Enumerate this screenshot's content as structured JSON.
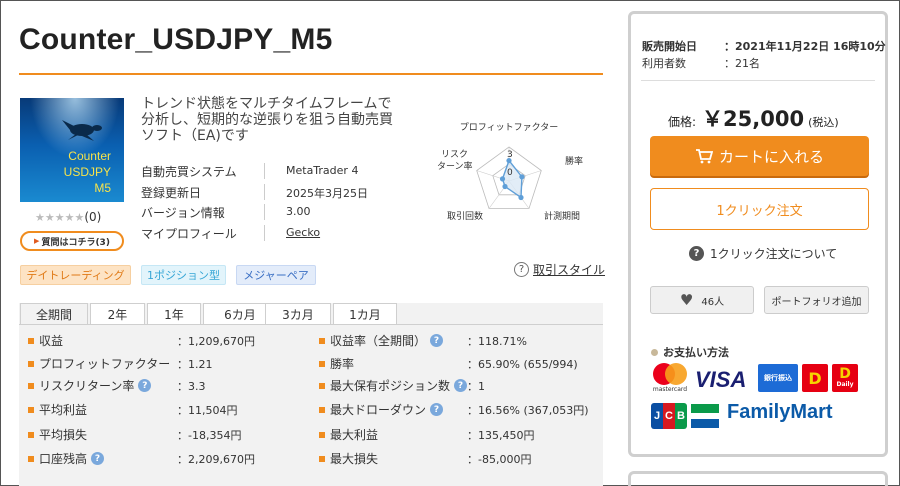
{
  "product": {
    "title": "Counter_USDJPY_M5",
    "image_lines": [
      "Counter",
      "USDJPY",
      "M5"
    ],
    "stars": "★★★★★",
    "review_count": "(0)",
    "qa_button": "質問はコチラ(3)",
    "description": "トレンド状態をマルチタイムフレームで分析し、短期的な逆張りを狙う自動売買ソフト（EA)です"
  },
  "info": [
    {
      "label": "自動売買システム",
      "value": "MetaTrader 4"
    },
    {
      "label": "登録更新日",
      "value": "2025年3月25日"
    },
    {
      "label": "バージョン情報",
      "value": "3.00"
    },
    {
      "label": "マイプロフィール",
      "value": "Gecko"
    }
  ],
  "radar": {
    "axes": [
      "プロフィットファクター",
      "勝率",
      "計測期間",
      "取引回数",
      "リスクターン率"
    ],
    "axis_label_lines": {
      "risk": [
        "リスク",
        "ターン率"
      ]
    },
    "values": [
      3,
      2,
      3,
      1,
      1
    ],
    "max": 5,
    "scale_labels": [
      "3",
      "0"
    ],
    "fill_color": "#dbe8f5",
    "stroke_color": "#5f9fd8"
  },
  "tags": [
    "デイトレーディング",
    "1ポジション型",
    "メジャーペア"
  ],
  "trade_style": {
    "icon": "?",
    "label": "取引スタイル"
  },
  "tabs": [
    "全期間",
    "2年",
    "1年",
    "6カ月",
    "3カ月",
    "1カ月"
  ],
  "active_tab": "全期間",
  "stats_left": [
    {
      "label": "収益",
      "value": "：1,209,670円",
      "help": false
    },
    {
      "label": "プロフィットファクター",
      "value": "：1.21",
      "help": false
    },
    {
      "label": "リスクリターン率",
      "value": "：3.3",
      "help": true
    },
    {
      "label": "平均利益",
      "value": "：11,504円",
      "help": false
    },
    {
      "label": "平均損失",
      "value": "：-18,354円",
      "help": false
    },
    {
      "label": "口座残高",
      "value": "：2,209,670円",
      "help": true
    }
  ],
  "stats_right": [
    {
      "label": "収益率（全期間）",
      "value": "：118.71%",
      "help": true
    },
    {
      "label": "勝率",
      "value": "：65.90% (655/994)",
      "help": false
    },
    {
      "label": "最大保有ポジション数",
      "value": "：1",
      "help": true
    },
    {
      "label": "最大ドローダウン",
      "value": "：16.56% (367,053円)",
      "help": true
    },
    {
      "label": "最大利益",
      "value": "：135,450円",
      "help": false
    },
    {
      "label": "最大損失",
      "value": "：-85,000円",
      "help": false
    }
  ],
  "help_icon": "?",
  "sidebar": {
    "sale_start_label": "販売開始日",
    "sale_start_value": "：2021年11月22日 16時10分",
    "users_label": "利用者数",
    "users_value": "：21名",
    "price_label": "価格:",
    "price_value": "￥25,000",
    "price_tax": "(税込)",
    "cart_button": "カートに入れる",
    "oneclick_button": "1クリック注文",
    "oneclick_help_icon": "?",
    "oneclick_help": "1クリック注文について",
    "favorite_count": "46人",
    "portfolio_button": "ポートフォリオ追加",
    "payment_title": "お支払い方法",
    "payment_logos": {
      "mastercard": "mastercard",
      "visa": "VISA",
      "bank": "銀行振込",
      "daily1": "D",
      "daily2": "D",
      "daily2_sub": "Daily",
      "jcb": [
        "J",
        "C",
        "B"
      ],
      "familymart": "FamilyMart"
    }
  },
  "colors": {
    "accent": "#f08c1e",
    "help_blue": "#7aa8dc",
    "jcb": [
      "#0b4ea2",
      "#d71920",
      "#0a9a4a"
    ]
  }
}
